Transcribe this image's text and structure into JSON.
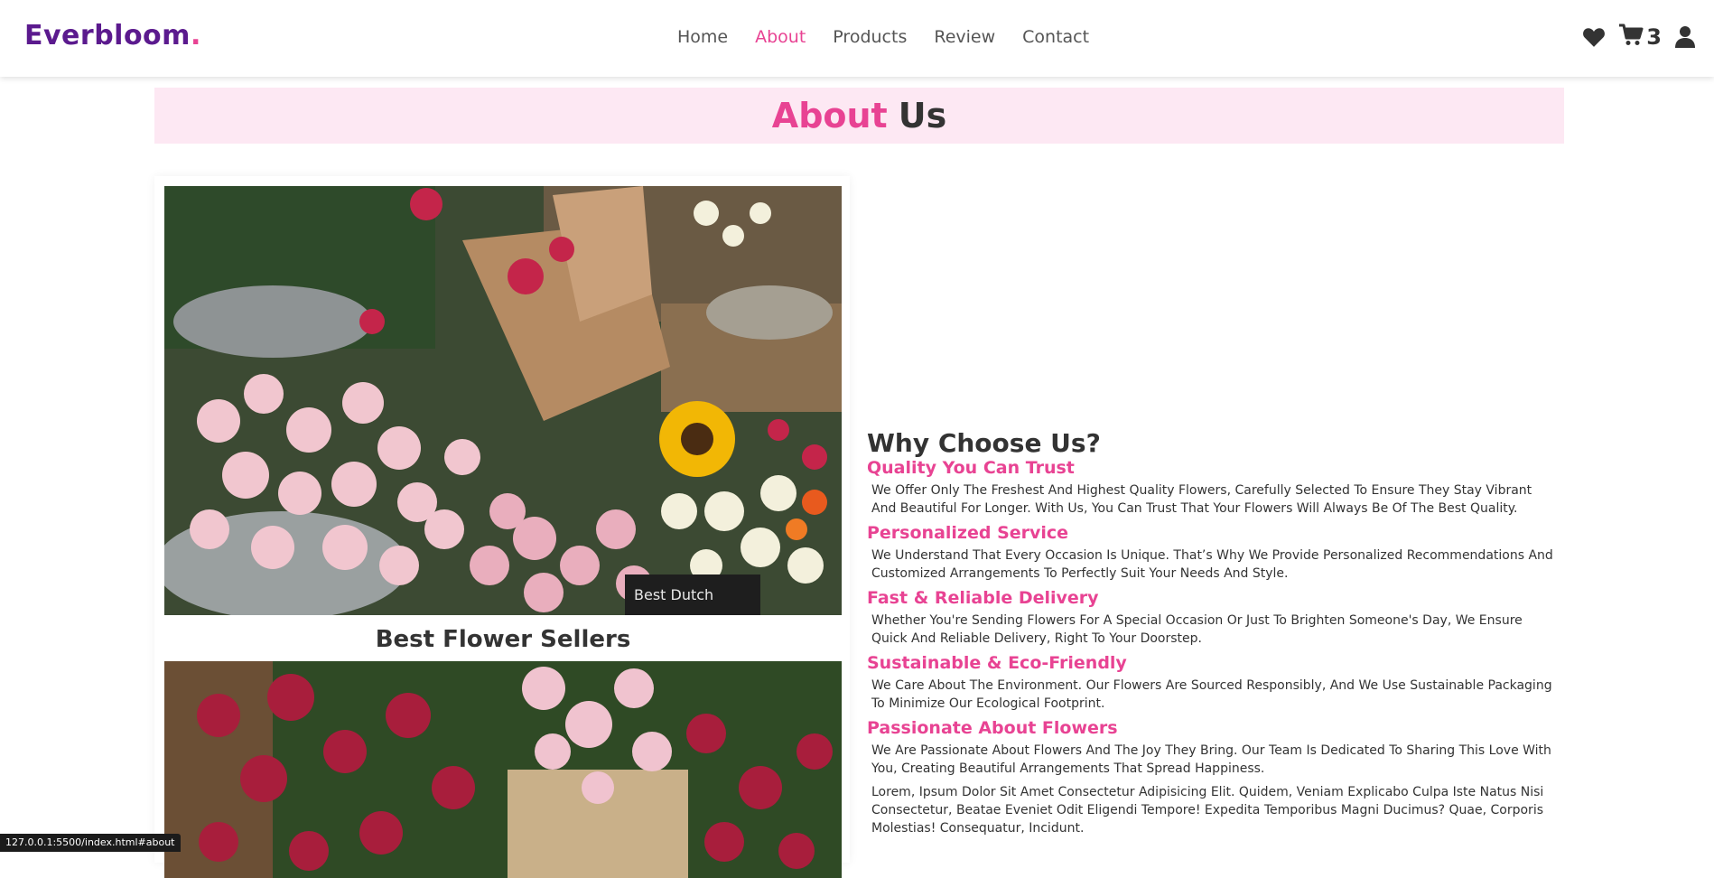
{
  "brand": {
    "name": "Everbloom",
    "dot": "."
  },
  "nav": [
    {
      "label": "Home",
      "active": false
    },
    {
      "label": "About",
      "active": true
    },
    {
      "label": "Products",
      "active": false
    },
    {
      "label": "Review",
      "active": false
    },
    {
      "label": "Contact",
      "active": false
    }
  ],
  "header_icons": {
    "heart": "heart-icon",
    "cart": "cart-icon",
    "user": "user-icon",
    "cart_count": "3"
  },
  "heading": {
    "accent": "About",
    "rest": "Us"
  },
  "left": {
    "caption": "Best Flower Sellers",
    "photo1": "flower-market-photo",
    "photo2": "peonies-photo"
  },
  "why": {
    "title": "Why Choose Us?",
    "items": [
      {
        "title": "Quality You Can Trust",
        "text": "We Offer Only The Freshest And Highest Quality Flowers, Carefully Selected To Ensure They Stay Vibrant And Beautiful For Longer. With Us, You Can Trust That Your Flowers Will Always Be Of The Best Quality."
      },
      {
        "title": "Personalized Service",
        "text": "We Understand That Every Occasion Is Unique. That’s Why We Provide Personalized Recommendations And Customized Arrangements To Perfectly Suit Your Needs And Style."
      },
      {
        "title": "Fast & Reliable Delivery",
        "text": "Whether You're Sending Flowers For A Special Occasion Or Just To Brighten Someone's Day, We Ensure Quick And Reliable Delivery, Right To Your Doorstep."
      },
      {
        "title": "Sustainable & Eco-Friendly",
        "text": "We Care About The Environment. Our Flowers Are Sourced Responsibly, And We Use Sustainable Packaging To Minimize Our Ecological Footprint."
      },
      {
        "title": "Passionate About Flowers",
        "text": "We Are Passionate About Flowers And The Joy They Bring. Our Team Is Dedicated To Sharing This Love With You, Creating Beautiful Arrangements That Spread Happiness."
      }
    ],
    "extra": "Lorem, Ipsum Dolor Sit Amet Consectetur Adipisicing Elit. Quidem, Veniam Explicabo Culpa Iste Natus Nisi Consectetur, Beatae Eveniet Odit Eligendi Tempore! Expedita Temporibus Magni Ducimus? Quae, Corporis Molestias! Consequatur, Incidunt."
  },
  "statusbar": "127.0.0.1:5500/index.html#about",
  "colors": {
    "accent": "#e84393",
    "brand": "#5b1a8e",
    "band": "#fde8f3"
  }
}
